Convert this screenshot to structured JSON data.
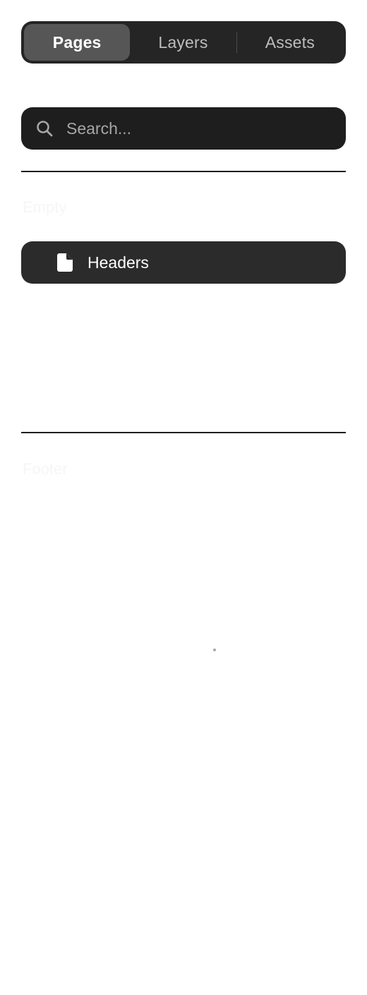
{
  "tabs": {
    "items": [
      {
        "label": "Pages",
        "active": true
      },
      {
        "label": "Layers",
        "active": false
      },
      {
        "label": "Assets",
        "active": false
      }
    ]
  },
  "search": {
    "placeholder": "Search...",
    "value": "",
    "icon": "search-icon"
  },
  "sections": [
    {
      "label": "Empty"
    },
    {
      "label": "Footer"
    }
  ],
  "pages": [
    {
      "label": "Headers",
      "icon": "file-icon"
    }
  ],
  "colors": {
    "panel": "#252525",
    "active_tab": "#565656",
    "search_bg": "#1e1e1e",
    "item_bg": "#2b2b2b",
    "text_primary": "#ffffff",
    "text_muted": "#bdbdbd"
  }
}
